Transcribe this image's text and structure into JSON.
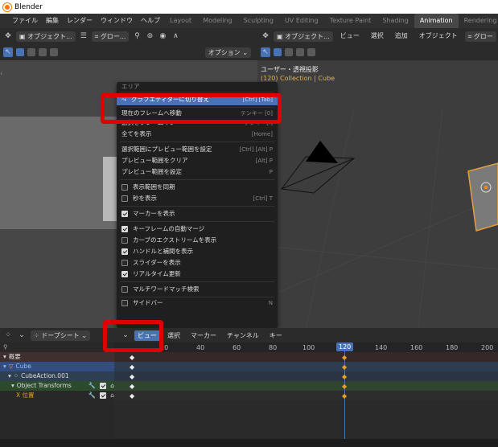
{
  "window": {
    "title": "Blender"
  },
  "menubar": {
    "items": [
      "ファイル",
      "編集",
      "レンダー",
      "ウィンドウ",
      "ヘルプ"
    ],
    "workspaces": [
      "Layout",
      "Modeling",
      "Sculpting",
      "UV Editing",
      "Texture Paint",
      "Shading",
      "Animation",
      "Rendering",
      "C"
    ],
    "active_workspace": "Animation"
  },
  "left_header": {
    "mode": "オブジェクト...",
    "transform": "グロー...",
    "options": "オプション"
  },
  "right_header": {
    "mode": "オブジェクト...",
    "menus": [
      "ビュー",
      "選択",
      "追加",
      "オブジェクト"
    ],
    "transform": "グロー"
  },
  "viewport": {
    "label": "ユーザー・透視投影",
    "collection": "(120) Collection | Cube"
  },
  "popup": {
    "top_partial": "エリア",
    "switch": {
      "label": "グラフエディターに切り替え",
      "shortcut": "[Ctrl] [Tab]"
    },
    "frame_items": [
      {
        "label": "現在のフレームへ移動",
        "shortcut": "テンキー [0]"
      },
      {
        "label": "選択をフレームイン",
        "shortcut": "テンキー[.]"
      },
      {
        "label": "全てを表示",
        "shortcut": "[Home]"
      }
    ],
    "preview_items": [
      {
        "label": "選択範囲にプレビュー範囲を設定",
        "shortcut": "[Ctrl] [Alt] P"
      },
      {
        "label": "プレビュー範囲をクリア",
        "shortcut": "[Alt] P"
      },
      {
        "label": "プレビュー範囲を設定",
        "shortcut": "P"
      }
    ],
    "sync_items": [
      {
        "label": "表示範囲を同期",
        "checked": false,
        "shortcut": ""
      },
      {
        "label": "秒を表示",
        "checked": false,
        "shortcut": "[Ctrl] T"
      }
    ],
    "marker_item": {
      "label": "マーカーを表示",
      "checked": true
    },
    "option_items": [
      {
        "label": "キーフレームの自動マージ",
        "checked": true
      },
      {
        "label": "カーブのエクストリームを表示",
        "checked": false
      },
      {
        "label": "ハンドルと補間を表示",
        "checked": true
      },
      {
        "label": "スライダーを表示",
        "checked": false
      },
      {
        "label": "リアルタイム更新",
        "checked": true
      }
    ],
    "multiword": {
      "label": "マルチワードマッチ検索",
      "checked": false
    },
    "bottom_partial": {
      "label": "サイドバー",
      "shortcut": "N"
    }
  },
  "dopesheet": {
    "editor": "ドープシート",
    "menus": [
      "ビュー",
      "選択",
      "マーカー",
      "チャンネル",
      "キー"
    ],
    "active_menu": "ビュー",
    "frames": [
      "20",
      "40",
      "60",
      "80",
      "100",
      "120",
      "140",
      "160",
      "180",
      "200"
    ],
    "current_frame": "120",
    "channels": [
      {
        "label": "概要"
      },
      {
        "label": "Cube"
      },
      {
        "label": "CubeAction.001"
      },
      {
        "label": "Object Transforms"
      },
      {
        "label": "X 位置"
      }
    ]
  }
}
